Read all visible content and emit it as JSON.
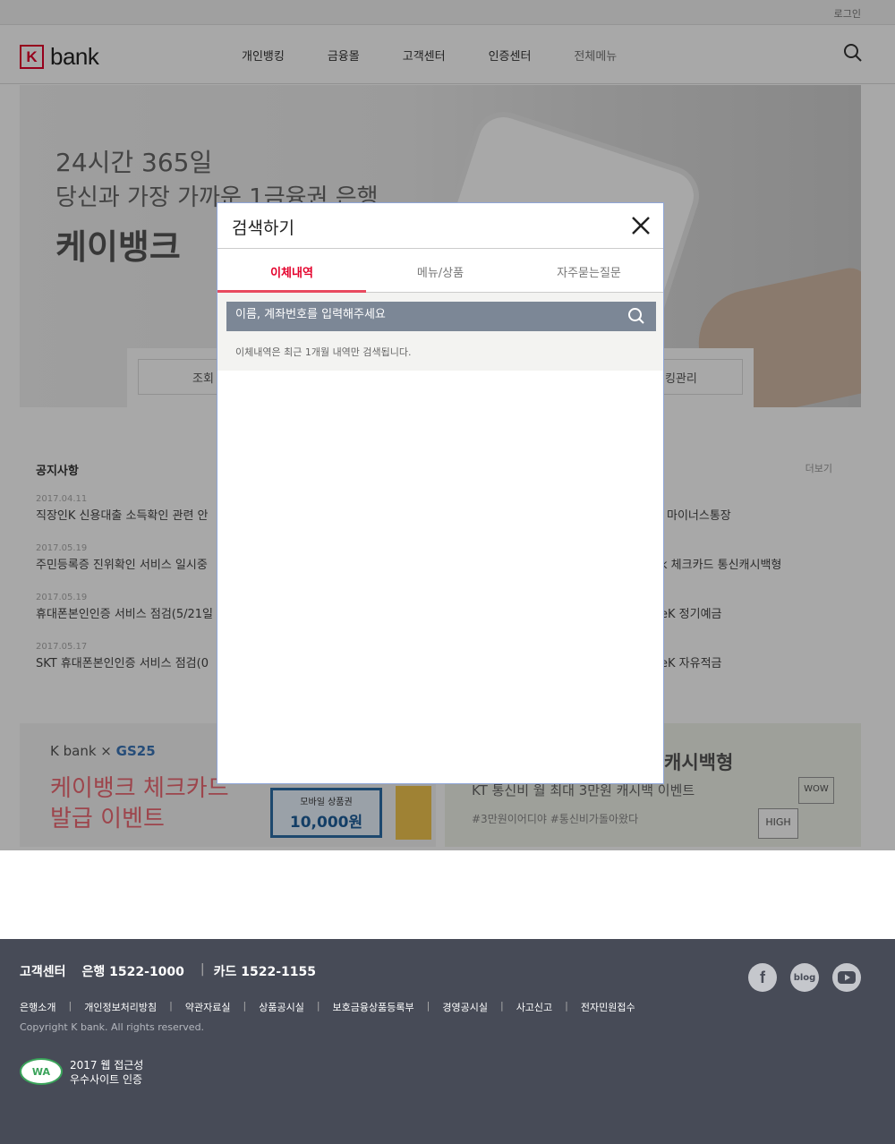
{
  "util": {
    "login": "로그인"
  },
  "header": {
    "logo_k": "K",
    "logo_word": "bank",
    "nav": [
      "개인뱅킹",
      "금융몰",
      "고객센터",
      "인증센터",
      "전체메뉴"
    ]
  },
  "hero": {
    "line1": "24시간 365일",
    "line2": "당신과 가장 가까운 1금융권 은행",
    "line3": "케이뱅크",
    "quick_left": "조회",
    "quick_right": "뱅킹관리"
  },
  "notices": {
    "title": "공지사항",
    "more": "더보기",
    "items": [
      {
        "date": "2017.04.11",
        "text": "직장인K 신용대출 소득확인 관련 안"
      },
      {
        "date": "2017.05.19",
        "text": "주민등록증 진위확인 서비스 일시중"
      },
      {
        "date": "2017.05.19",
        "text": "휴대폰본인인증 서비스 점검(5/21일"
      },
      {
        "date": "2017.05.17",
        "text": "SKT 휴대폰본인인증 서비스 점검(0"
      }
    ],
    "products": [
      "마이너스통장",
      "k 체크카드 통신캐시백형",
      "eK 정기예금",
      "eK 자유적금"
    ]
  },
  "banner_left": {
    "brand_k": "K bank",
    "brand_x": "×",
    "brand_gs": "GS25",
    "line1": "케이뱅크 체크카드",
    "line2": "발급 이벤트",
    "voucher_label": "모바일 상품권",
    "voucher_value": "10,000원"
  },
  "banner_right": {
    "line1": "캐시백형",
    "line2": "KT 통신비 월 최대 3만원 캐시백 이벤트",
    "line3": "#3만원이어디야 #통신비가돌아왔다",
    "sign1": "HIGH",
    "sign2": "WOW"
  },
  "modal": {
    "title": "검색하기",
    "tabs": [
      "이체내역",
      "메뉴/상품",
      "자주묻는질문"
    ],
    "active_tab": "이체내역",
    "search_placeholder": "이름, 계좌번호를 입력해주세요",
    "note": "이체내역은 최근 1개월 내역만 검색됩니다."
  },
  "footer": {
    "cs_label": "고객센터",
    "bank_phone": "은행 1522-1000",
    "card_phone": "카드 1522-1155",
    "links": [
      "은행소개",
      "개인정보처리방침",
      "약관자료실",
      "상품공시실",
      "보호금융상품등록부",
      "경영공시실",
      "사고신고",
      "전자민원접수"
    ],
    "copyright": "Copyright K bank. All rights reserved.",
    "wa_mark": "WA",
    "cert_line1": "2017 웹 접근성",
    "cert_line2": "우수사이트 인증",
    "sns": {
      "facebook": "f",
      "blog": "blog"
    }
  },
  "colors": {
    "brand_red": "#e4002b",
    "footer_bg": "#474b57",
    "search_bar": "#7c8796"
  }
}
